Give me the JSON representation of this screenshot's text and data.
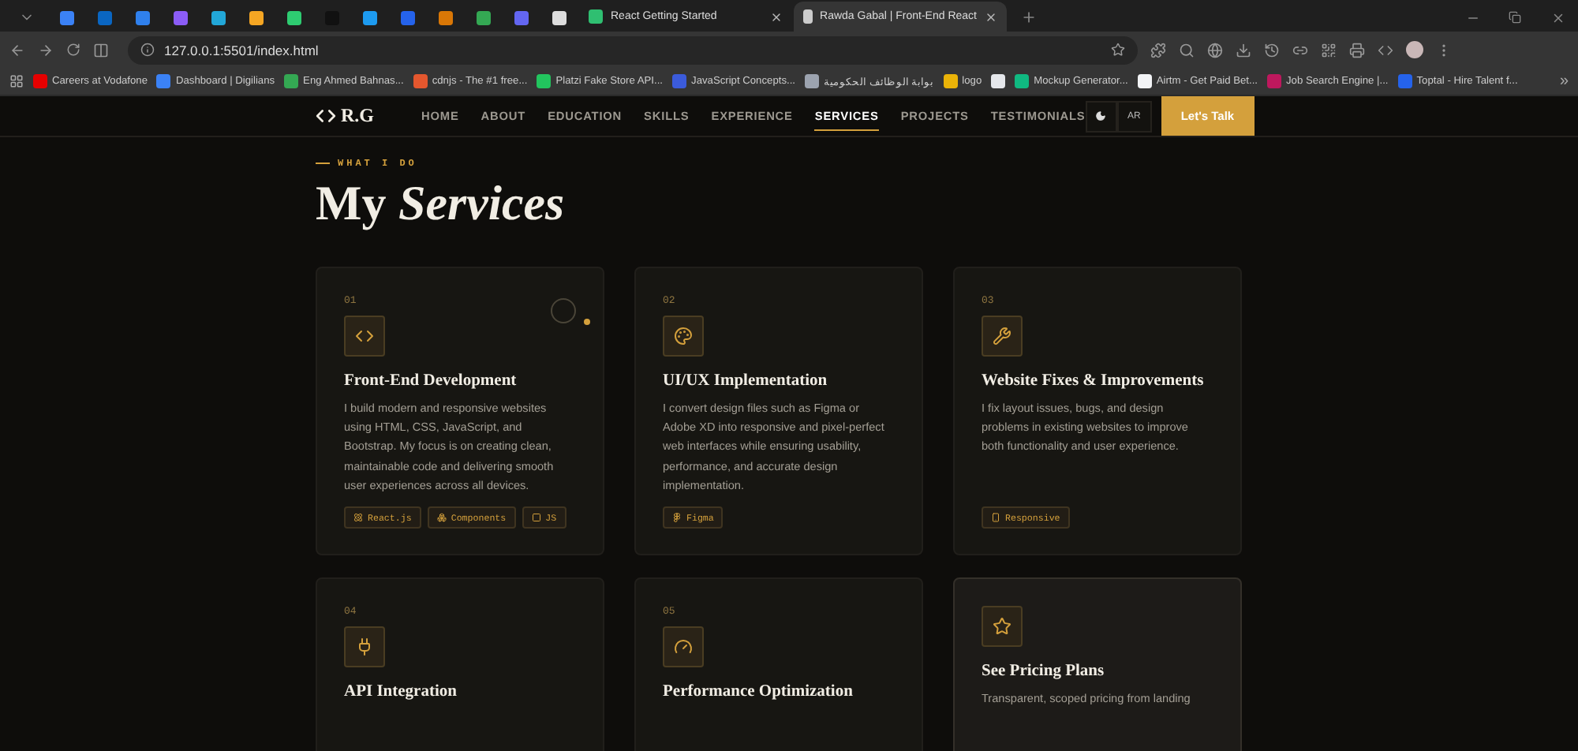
{
  "browser": {
    "tabs": [
      {
        "kind": "icon",
        "color": "#3b82f6",
        "selected": false
      },
      {
        "kind": "icon",
        "color": "#0a66c2",
        "selected": false
      },
      {
        "kind": "icon",
        "color": "#2f80ed",
        "selected": false
      },
      {
        "kind": "icon",
        "color": "#8b5cf6",
        "selected": false
      },
      {
        "kind": "icon",
        "color": "#22a7d8",
        "selected": false
      },
      {
        "kind": "icon",
        "color": "#f5a623",
        "selected": false
      },
      {
        "kind": "icon",
        "color": "#2ecc71",
        "selected": false
      },
      {
        "kind": "icon",
        "color": "#111111",
        "selected": false
      },
      {
        "kind": "icon",
        "color": "#1d9bf0",
        "selected": false
      },
      {
        "kind": "icon",
        "color": "#2563eb",
        "selected": false
      },
      {
        "kind": "icon",
        "color": "#d97706",
        "selected": false
      },
      {
        "kind": "icon",
        "color": "#34a853",
        "selected": false
      },
      {
        "kind": "icon",
        "color": "#6366f1",
        "selected": false
      },
      {
        "kind": "icon",
        "color": "#dddddd",
        "selected": false
      },
      {
        "kind": "page",
        "title": "React Getting Started",
        "color": "#2fbf71",
        "selected": false
      },
      {
        "kind": "page",
        "title": "Rawda Gabal | Front-End React",
        "color": "#cccccc",
        "selected": true
      }
    ],
    "url": "127.0.0.1:5501/index.html",
    "bookmarks": [
      {
        "label": "Careers at Vodafone",
        "color": "#e60000"
      },
      {
        "label": "Dashboard | Digilians",
        "color": "#3b82f6"
      },
      {
        "label": "Eng Ahmed Bahnas...",
        "color": "#34a853"
      },
      {
        "label": "cdnjs - The #1 free...",
        "color": "#e4572e"
      },
      {
        "label": "Platzi Fake Store API...",
        "color": "#22c55e"
      },
      {
        "label": "JavaScript Concepts...",
        "color": "#3b5bdb"
      },
      {
        "label": "بوابة الوظائف الحكومية",
        "color": "#9ca3af"
      },
      {
        "label": "logo",
        "color": "#eab308"
      },
      {
        "color": "#e5e7eb"
      },
      {
        "label": "Mockup Generator...",
        "color": "#10b981"
      },
      {
        "label": "Airtm - Get Paid Bet...",
        "color": "#f3f4f6"
      },
      {
        "label": "Job Search Engine |...",
        "color": "#be185d"
      },
      {
        "label": "Toptal - Hire Talent f...",
        "color": "#2563eb"
      }
    ],
    "more": "»"
  },
  "site": {
    "logo": "R.G",
    "nav": [
      {
        "label": "HOME",
        "selected": false
      },
      {
        "label": "ABOUT",
        "selected": false
      },
      {
        "label": "EDUCATION",
        "selected": false
      },
      {
        "label": "SKILLS",
        "selected": false
      },
      {
        "label": "EXPERIENCE",
        "selected": false
      },
      {
        "label": "SERVICES",
        "selected": true
      },
      {
        "label": "PROJECTS",
        "selected": false
      },
      {
        "label": "TESTIMONIALS",
        "selected": false
      }
    ],
    "language": "AR",
    "cta": "Let's Talk",
    "eyebrow": "WHAT I DO",
    "heading": "My *Services*",
    "cards": [
      {
        "kind": "service",
        "number": "01",
        "title": "Front-End Development",
        "description": "I build modern and responsive websites using HTML, CSS, JavaScript, and Bootstrap. My focus is on creating clean, maintainable code and delivering smooth user experiences across all devices.",
        "tags": [
          "React.js",
          "Components",
          "JS"
        ]
      },
      {
        "kind": "service",
        "number": "02",
        "title": "UI/UX Implementation",
        "description": "I convert design files such as Figma or Adobe XD into responsive and pixel-perfect web interfaces while ensuring usability, performance, and accurate design implementation.",
        "tags": [
          "Figma"
        ]
      },
      {
        "kind": "service",
        "number": "03",
        "title": "Website Fixes & Improvements",
        "description": "I fix layout issues, bugs, and design problems in existing websites to improve both functionality and user experience.",
        "tags": [
          "Responsive"
        ]
      },
      {
        "kind": "service",
        "number": "04",
        "title": "API Integration"
      },
      {
        "kind": "service",
        "number": "05",
        "title": "Performance Optimization"
      },
      {
        "kind": "cta",
        "title": "See Pricing Plans",
        "description": "Transparent, scoped pricing from landing"
      }
    ]
  }
}
